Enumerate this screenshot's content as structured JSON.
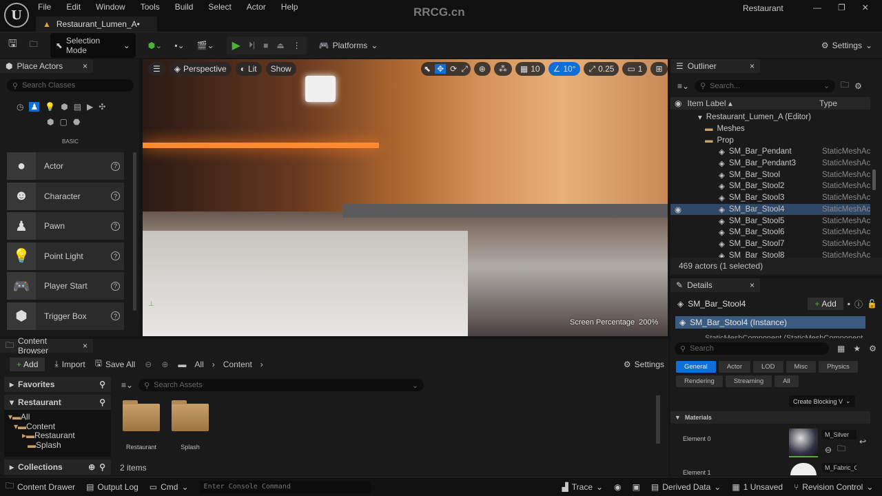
{
  "menu": [
    "File",
    "Edit",
    "Window",
    "Tools",
    "Build",
    "Select",
    "Actor",
    "Help"
  ],
  "document_tab": "Restaurant_Lumen_A•",
  "watermark": "RRCG.cn",
  "project_name": "Restaurant",
  "toolbar": {
    "selection_mode": "Selection Mode",
    "platforms": "Platforms",
    "settings": "Settings"
  },
  "place_actors": {
    "title": "Place Actors",
    "search_placeholder": "Search Classes",
    "category": "BASIC",
    "items": [
      {
        "label": "Actor",
        "icon": "sphere-icon"
      },
      {
        "label": "Character",
        "icon": "character-icon"
      },
      {
        "label": "Pawn",
        "icon": "pawn-icon"
      },
      {
        "label": "Point Light",
        "icon": "bulb-icon"
      },
      {
        "label": "Player Start",
        "icon": "gamepad-icon"
      },
      {
        "label": "Trigger Box",
        "icon": "box-icon"
      }
    ]
  },
  "viewport": {
    "perspective": "Perspective",
    "lit": "Lit",
    "show": "Show",
    "grid": "10",
    "angle": "10°",
    "scale": "0.25",
    "camera": "1",
    "screen_percentage_label": "Screen Percentage",
    "screen_percentage": "200%"
  },
  "outliner": {
    "title": "Outliner",
    "search_placeholder": "Search...",
    "col_label": "Item Label ▴",
    "col_type": "Type",
    "root": "Restaurant_Lumen_A (Editor)",
    "folders": [
      "Meshes",
      "Prop"
    ],
    "rows": [
      {
        "label": "SM_Bar_Pendant",
        "type": "StaticMeshAc"
      },
      {
        "label": "SM_Bar_Pendant3",
        "type": "StaticMeshAc"
      },
      {
        "label": "SM_Bar_Stool",
        "type": "StaticMeshAc"
      },
      {
        "label": "SM_Bar_Stool2",
        "type": "StaticMeshAc"
      },
      {
        "label": "SM_Bar_Stool3",
        "type": "StaticMeshAc"
      },
      {
        "label": "SM_Bar_Stool4",
        "type": "StaticMeshAc",
        "selected": true
      },
      {
        "label": "SM_Bar_Stool5",
        "type": "StaticMeshAc"
      },
      {
        "label": "SM_Bar_Stool6",
        "type": "StaticMeshAc"
      },
      {
        "label": "SM_Bar_Stool7",
        "type": "StaticMeshAc"
      },
      {
        "label": "SM_Bar_Stool8",
        "type": "StaticMeshAc"
      }
    ],
    "count": "469 actors (1 selected)"
  },
  "details": {
    "title": "Details",
    "object": "SM_Bar_Stool4",
    "add": "Add",
    "instance": "SM_Bar_Stool4 (Instance)",
    "component": "StaticMeshComponent (StaticMeshComponent",
    "search_placeholder": "Search",
    "tabs": [
      "General",
      "Actor",
      "LOD",
      "Misc",
      "Physics",
      "Rendering",
      "Streaming",
      "All"
    ],
    "active_tab": "General",
    "blocking": "Create Blocking V",
    "materials_section": "Materials",
    "elements": [
      {
        "label": "Element 0",
        "material": "M_Silver"
      },
      {
        "label": "Element 1",
        "material": "M_Fabric_C"
      }
    ]
  },
  "content_browser": {
    "title": "Content Browser",
    "add": "Add",
    "import": "Import",
    "save_all": "Save All",
    "breadcrumb": [
      "All",
      "Content"
    ],
    "settings": "Settings",
    "favorites": "Favorites",
    "project": "Restaurant",
    "tree": [
      "All",
      "Content",
      "Restaurant",
      "Splash"
    ],
    "collections": "Collections",
    "search_placeholder": "Search Assets",
    "assets": [
      "Restaurant",
      "Splash"
    ],
    "count": "2 items"
  },
  "status": {
    "content_drawer": "Content Drawer",
    "output_log": "Output Log",
    "cmd": "Cmd",
    "console_placeholder": "Enter Console Command",
    "trace": "Trace",
    "derived_data": "Derived Data",
    "unsaved": "1 Unsaved",
    "revision_control": "Revision Control"
  },
  "colors": {
    "accent": "#0f6fd8",
    "selection": "#2f4866",
    "play": "#4cb336"
  }
}
